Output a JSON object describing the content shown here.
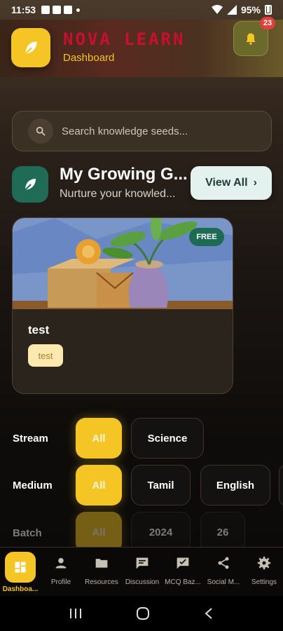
{
  "status_bar": {
    "time": "11:53",
    "battery": "95%",
    "notification_icons": [
      "gallery-icon",
      "checkbox-icon",
      "facebook-icon"
    ]
  },
  "header": {
    "app_name": "NOVA LEARN",
    "subtitle": "Dashboard",
    "notification_count": "23",
    "brand_color": "#c8102e",
    "accent_color": "#f4c524"
  },
  "search": {
    "placeholder": "Search knowledge seeds..."
  },
  "section": {
    "title": "My Growing G...",
    "subtitle": "Nurture your knowled...",
    "view_all_label": "View All"
  },
  "course_card": {
    "badge": "FREE",
    "title": "test",
    "tag": "test"
  },
  "filters": {
    "stream": {
      "label": "Stream",
      "options": [
        "All",
        "Science"
      ],
      "selected": "All"
    },
    "medium": {
      "label": "Medium",
      "options": [
        "All",
        "Tamil",
        "English"
      ],
      "selected": "All"
    },
    "batch": {
      "label": "Batch",
      "options": [
        "All",
        "2024",
        "26"
      ],
      "selected": "All"
    }
  },
  "bottom_nav": {
    "items": [
      {
        "label": "Dashboa...",
        "icon": "dashboard-icon",
        "active": true
      },
      {
        "label": "Profile",
        "icon": "person-icon"
      },
      {
        "label": "Resources",
        "icon": "folder-icon"
      },
      {
        "label": "Discussion",
        "icon": "chat-icon"
      },
      {
        "label": "MCQ Baz...",
        "icon": "quiz-icon"
      },
      {
        "label": "Social M...",
        "icon": "share-icon"
      },
      {
        "label": "Settings",
        "icon": "gear-icon"
      }
    ]
  }
}
